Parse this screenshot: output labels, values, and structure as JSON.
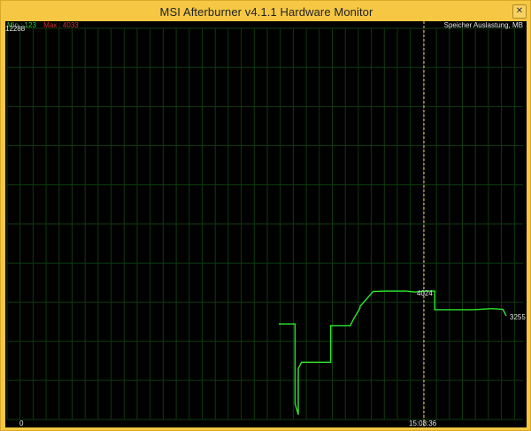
{
  "window": {
    "title": "MSI Afterburner v4.1.1 Hardware Monitor",
    "close_glyph": "✕"
  },
  "graph": {
    "y_max_label": "12288",
    "y_min_label": "0",
    "min_text": "Min : 123",
    "max_text": "Max : 4033",
    "series_name": "Speicher Auslastung, MB",
    "cursor_value": "4024",
    "cursor_time": "15:08:36",
    "current_value": "3255",
    "colors": {
      "background": "#000000",
      "grid": "#0f3a0f",
      "line": "#2ee62e",
      "cursor": "#f0d050",
      "min": "#2ad12a",
      "max": "#d93030"
    }
  },
  "chart_data": {
    "type": "line",
    "title": "",
    "ylabel": "Speicher Auslastung, MB",
    "ylim": [
      0,
      12288
    ],
    "series": [
      {
        "name": "Speicher Auslastung, MB",
        "x": [
          0,
          4,
          5,
          5,
          6,
          6,
          7,
          9,
          11,
          15,
          16,
          16,
          22,
          23,
          25,
          25,
          29,
          33,
          39,
          42,
          44,
          45,
          46,
          46,
          48,
          48,
          50,
          53,
          60,
          65,
          66,
          69,
          69,
          70,
          70
        ],
        "values": [
          3000,
          3000,
          3000,
          500,
          150,
          1600,
          1800,
          1800,
          1800,
          1800,
          1800,
          2950,
          2950,
          3150,
          3500,
          3550,
          4020,
          4030,
          4033,
          4000,
          4024,
          4030,
          4030,
          4030,
          4030,
          3450,
          3450,
          3450,
          3450,
          3480,
          3480,
          3460,
          3460,
          3255,
          3255
        ]
      }
    ],
    "cursor_label": "15:08:36"
  }
}
